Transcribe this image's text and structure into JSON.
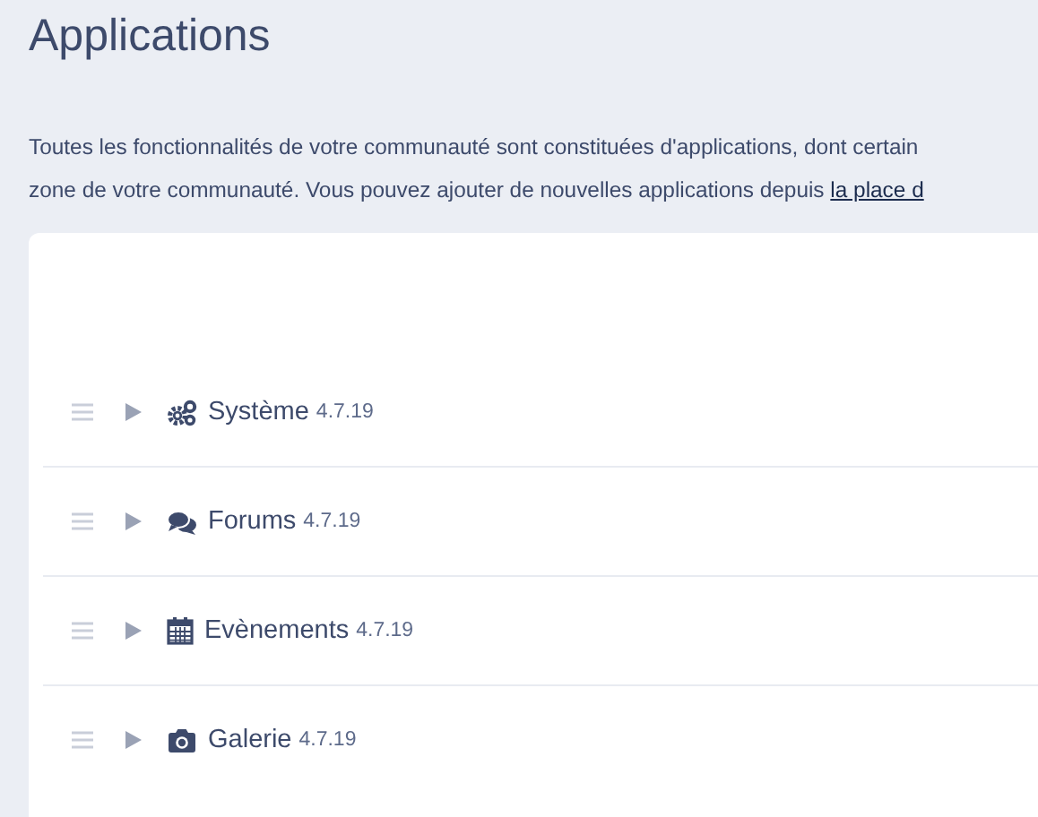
{
  "page_title": "Applications",
  "intro": {
    "line_1": "Toutes les fonctionnalités de votre communauté sont constituées d'applications, dont certain",
    "line_2": "zone de votre communauté. Vous pouvez ajouter de nouvelles applications depuis",
    "link": "la place d"
  },
  "applications": [
    {
      "name": "Système",
      "version": "4.7.19",
      "expanded": false
    },
    {
      "name": "Forums",
      "version": "4.7.19",
      "expanded": false
    },
    {
      "name": "Evènements",
      "version": "4.7.19",
      "expanded": false
    },
    {
      "name": "Galerie",
      "version": "4.7.19",
      "expanded": false
    }
  ]
}
